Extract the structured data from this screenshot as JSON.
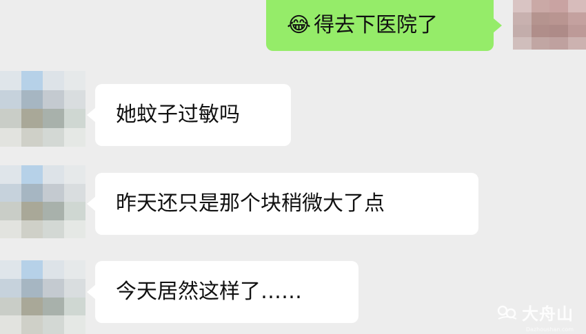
{
  "messages": [
    {
      "direction": "out",
      "emoji": "😂",
      "text": "得去下医院了"
    },
    {
      "direction": "in",
      "text": "她蚊子过敏吗"
    },
    {
      "direction": "in",
      "text": "昨天还只是那个块稍微大了点"
    },
    {
      "direction": "in",
      "text": "今天居然这样了……"
    }
  ],
  "watermark": {
    "name": "大舟山",
    "url": "Dazhoushan.com"
  },
  "colors": {
    "background": "#ededed",
    "incoming_bubble": "#ffffff",
    "outgoing_bubble": "#95ec69"
  }
}
